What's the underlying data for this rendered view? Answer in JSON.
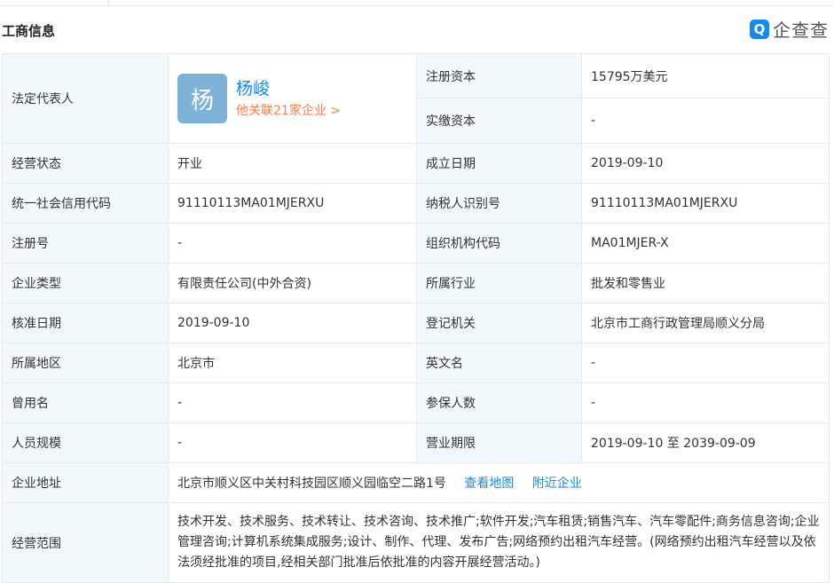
{
  "section": {
    "title": "工商信息"
  },
  "brand": {
    "icon_char": "Q",
    "name": "企查查",
    "color": "#128bed"
  },
  "legal_rep": {
    "label": "法定代表人",
    "avatar_char": "杨",
    "name": "杨峻",
    "related": "他关联21家企业 >"
  },
  "capital": {
    "registered_label": "注册资本",
    "registered_value": "15795万美元",
    "paid_label": "实缴资本",
    "paid_value": "-"
  },
  "rows": [
    {
      "l1": "经营状态",
      "v1": "开业",
      "l2": "成立日期",
      "v2": "2019-09-10"
    },
    {
      "l1": "统一社会信用代码",
      "v1": "91110113MA01MJERXU",
      "l2": "纳税人识别号",
      "v2": "91110113MA01MJERXU"
    },
    {
      "l1": "注册号",
      "v1": "-",
      "l2": "组织机构代码",
      "v2": "MA01MJER-X"
    },
    {
      "l1": "企业类型",
      "v1": "有限责任公司(中外合资)",
      "l2": "所属行业",
      "v2": "批发和零售业"
    },
    {
      "l1": "核准日期",
      "v1": "2019-09-10",
      "l2": "登记机关",
      "v2": "北京市工商行政管理局顺义分局"
    },
    {
      "l1": "所属地区",
      "v1": "北京市",
      "l2": "英文名",
      "v2": "-"
    },
    {
      "l1": "曾用名",
      "v1": "-",
      "l2": "参保人数",
      "v2": "-"
    },
    {
      "l1": "人员规模",
      "v1": "-",
      "l2": "营业期限",
      "v2": "2019-09-10 至 2039-09-09"
    }
  ],
  "address": {
    "label": "企业地址",
    "value": "北京市顺义区中关村科技园区顺义园临空二路1号",
    "map_link": "查看地图",
    "nearby_link": "附近企业"
  },
  "scope": {
    "label": "经营范围",
    "value": "技术开发、技术服务、技术转让、技术咨询、技术推广;软件开发;汽车租赁;销售汽车、汽车零配件;商务信息咨询;企业管理咨询;计算机系统集成服务;设计、制作、代理、发布广告;网络预约出租汽车经营。(网络预约出租汽车经营以及依法须经批准的项目,经相关部门批准后依批准的内容开展经营活动。)"
  }
}
